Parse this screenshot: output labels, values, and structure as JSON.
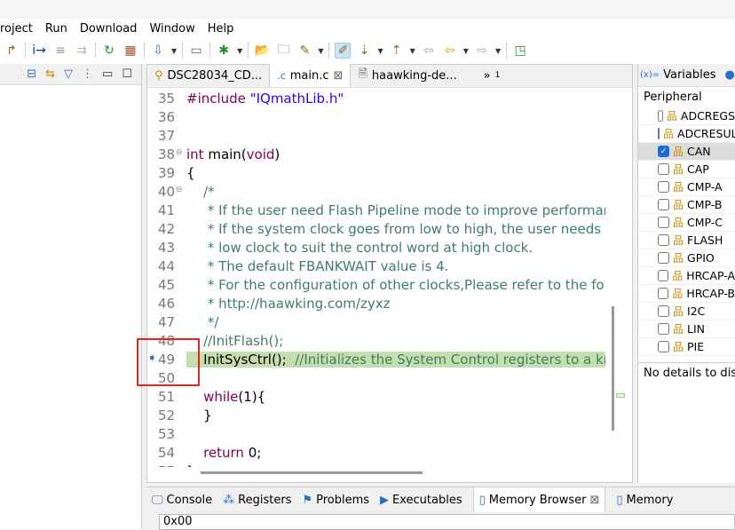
{
  "menu": [
    "roject",
    "Run",
    "Download",
    "Window",
    "Help"
  ],
  "editor": {
    "tabs": [
      {
        "label": "DSC28034_CD...",
        "icon": "project-icon"
      },
      {
        "label": "main.c",
        "icon": "c-file-icon",
        "active": true
      },
      {
        "label": "haawking-de...",
        "icon": "document-icon"
      }
    ],
    "overflow": "»",
    "overflow_count": "1",
    "lines": [
      {
        "n": "35",
        "parts": [
          [
            "kw",
            "#include "
          ],
          [
            "str",
            "\"IQmathLib.h\""
          ]
        ]
      },
      {
        "n": "36",
        "parts": []
      },
      {
        "n": "37",
        "parts": []
      },
      {
        "n": "38",
        "fold": true,
        "parts": [
          [
            "kw",
            "int "
          ],
          [
            "",
            "main("
          ],
          [
            "kw",
            "void"
          ],
          [
            "",
            ")"
          ]
        ]
      },
      {
        "n": "39",
        "parts": [
          [
            "",
            "{"
          ]
        ]
      },
      {
        "n": "40",
        "fold": true,
        "parts": [
          [
            "cm",
            "    /*"
          ]
        ]
      },
      {
        "n": "41",
        "parts": [
          [
            "cm",
            "     * If the user need Flash Pipeline mode to improve performance"
          ]
        ]
      },
      {
        "n": "42",
        "parts": [
          [
            "cm",
            "     * If the system clock goes from low to high, the user needs to"
          ]
        ]
      },
      {
        "n": "43",
        "parts": [
          [
            "cm",
            "     * low clock to suit the control word at high clock."
          ]
        ]
      },
      {
        "n": "44",
        "parts": [
          [
            "cm",
            "     * The default FBANKWAIT value is 4."
          ]
        ]
      },
      {
        "n": "45",
        "parts": [
          [
            "cm",
            "     * For the configuration of other clocks,Please refer to the following"
          ]
        ]
      },
      {
        "n": "46",
        "parts": [
          [
            "cm",
            "     * http://haawking.com/zyxz"
          ]
        ]
      },
      {
        "n": "47",
        "parts": [
          [
            "cm",
            "     */"
          ]
        ]
      },
      {
        "n": "48",
        "parts": [
          [
            "cm",
            "    //InitFlash();"
          ]
        ]
      },
      {
        "n": "49",
        "current": true,
        "parts": [
          [
            "",
            "    InitSysCtrl();  "
          ],
          [
            "cm",
            "//Initializes the System Control registers to a known state"
          ]
        ]
      },
      {
        "n": "50",
        "parts": []
      },
      {
        "n": "51",
        "parts": [
          [
            "kw",
            "    while"
          ],
          [
            "",
            "(1){"
          ]
        ]
      },
      {
        "n": "52",
        "parts": [
          [
            "",
            "    }"
          ]
        ]
      },
      {
        "n": "53",
        "parts": []
      },
      {
        "n": "54",
        "parts": [
          [
            "kw",
            "    return "
          ],
          [
            "",
            "0;"
          ]
        ]
      },
      {
        "n": "55",
        "parts": [
          [
            "",
            "}"
          ]
        ]
      }
    ]
  },
  "right": {
    "tabs": [
      "Variables",
      "B"
    ],
    "header": "Peripheral",
    "items": [
      {
        "label": "ADCREGS",
        "checked": false
      },
      {
        "label": "ADCRESULT",
        "checked": false
      },
      {
        "label": "CAN",
        "checked": true
      },
      {
        "label": "CAP",
        "checked": false
      },
      {
        "label": "CMP-A",
        "checked": false
      },
      {
        "label": "CMP-B",
        "checked": false
      },
      {
        "label": "CMP-C",
        "checked": false
      },
      {
        "label": "FLASH",
        "checked": false
      },
      {
        "label": "GPIO",
        "checked": false
      },
      {
        "label": "HRCAP-A",
        "checked": false
      },
      {
        "label": "HRCAP-B",
        "checked": false
      },
      {
        "label": "I2C",
        "checked": false
      },
      {
        "label": "LIN",
        "checked": false
      },
      {
        "label": "PIE",
        "checked": false
      }
    ],
    "details": "No details to display"
  },
  "bottom": {
    "tabs": [
      {
        "label": "Console",
        "icon": "console-icon"
      },
      {
        "label": "Registers",
        "icon": "registers-icon"
      },
      {
        "label": "Problems",
        "icon": "problems-icon"
      },
      {
        "label": "Executables",
        "icon": "executables-icon"
      },
      {
        "label": "Memory Browser",
        "icon": "memory-icon",
        "active": true
      },
      {
        "label": "Memory",
        "icon": "memory-icon"
      }
    ],
    "address": "0x00"
  },
  "colors": {
    "current_line": "#c5deb0",
    "annotation": "#f02020",
    "accent": "#1e6ad6"
  }
}
